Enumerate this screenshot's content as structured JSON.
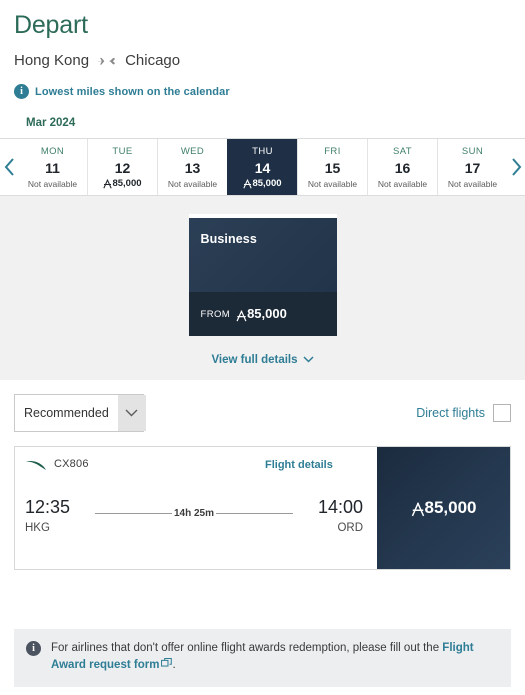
{
  "header": {
    "title": "Depart",
    "origin_city": "Hong Kong",
    "destination_city": "Chicago",
    "plane_icon": "plane-icon",
    "lowest_miles_note": "Lowest miles shown on the calendar",
    "info_icon": "info-icon"
  },
  "calendar": {
    "month": "Mar 2024",
    "prev_icon": "chevron-left-icon",
    "next_icon": "chevron-right-icon",
    "not_available_label": "Not available",
    "days": [
      {
        "dow": "MON",
        "num": "11",
        "status": "Not available",
        "miles": "",
        "selected": false
      },
      {
        "dow": "TUE",
        "num": "12",
        "status": "",
        "miles": "85,000",
        "selected": false
      },
      {
        "dow": "WED",
        "num": "13",
        "status": "Not available",
        "miles": "",
        "selected": false
      },
      {
        "dow": "THU",
        "num": "14",
        "status": "",
        "miles": "85,000",
        "selected": true
      },
      {
        "dow": "FRI",
        "num": "15",
        "status": "Not available",
        "miles": "",
        "selected": false
      },
      {
        "dow": "SAT",
        "num": "16",
        "status": "Not available",
        "miles": "",
        "selected": false
      },
      {
        "dow": "SUN",
        "num": "17",
        "status": "Not available",
        "miles": "",
        "selected": false
      }
    ]
  },
  "cabin": {
    "name": "Business",
    "from_label": "FROM",
    "price": "85,000",
    "view_details_label": "View full details",
    "chevron_icon": "chevron-down-icon"
  },
  "filters": {
    "sort_value": "Recommended",
    "sort_caret_icon": "chevron-down-icon",
    "direct_flights_label": "Direct flights",
    "direct_flights_checked": false
  },
  "flight": {
    "airline_logo": "cathay-brushwing-icon",
    "flight_number": "CX806",
    "details_link": "Flight details",
    "depart_time": "12:35",
    "depart_code": "HKG",
    "duration": "14h 25m",
    "arrive_time": "14:00",
    "arrive_code": "ORD",
    "price": "85,000"
  },
  "notice": {
    "icon": "info-icon",
    "text_before": "For airlines that don't offer online flight awards redemption, please fill out the",
    "link_label": "Flight Award request form",
    "external_icon": "external-link-icon",
    "text_after": "."
  },
  "colors": {
    "title_green": "#2d6b59",
    "teal_link": "#2e7d95",
    "selected_navy": "#1f3046",
    "panel_gray": "#f1f1f1",
    "notice_gray": "#eceef0"
  }
}
